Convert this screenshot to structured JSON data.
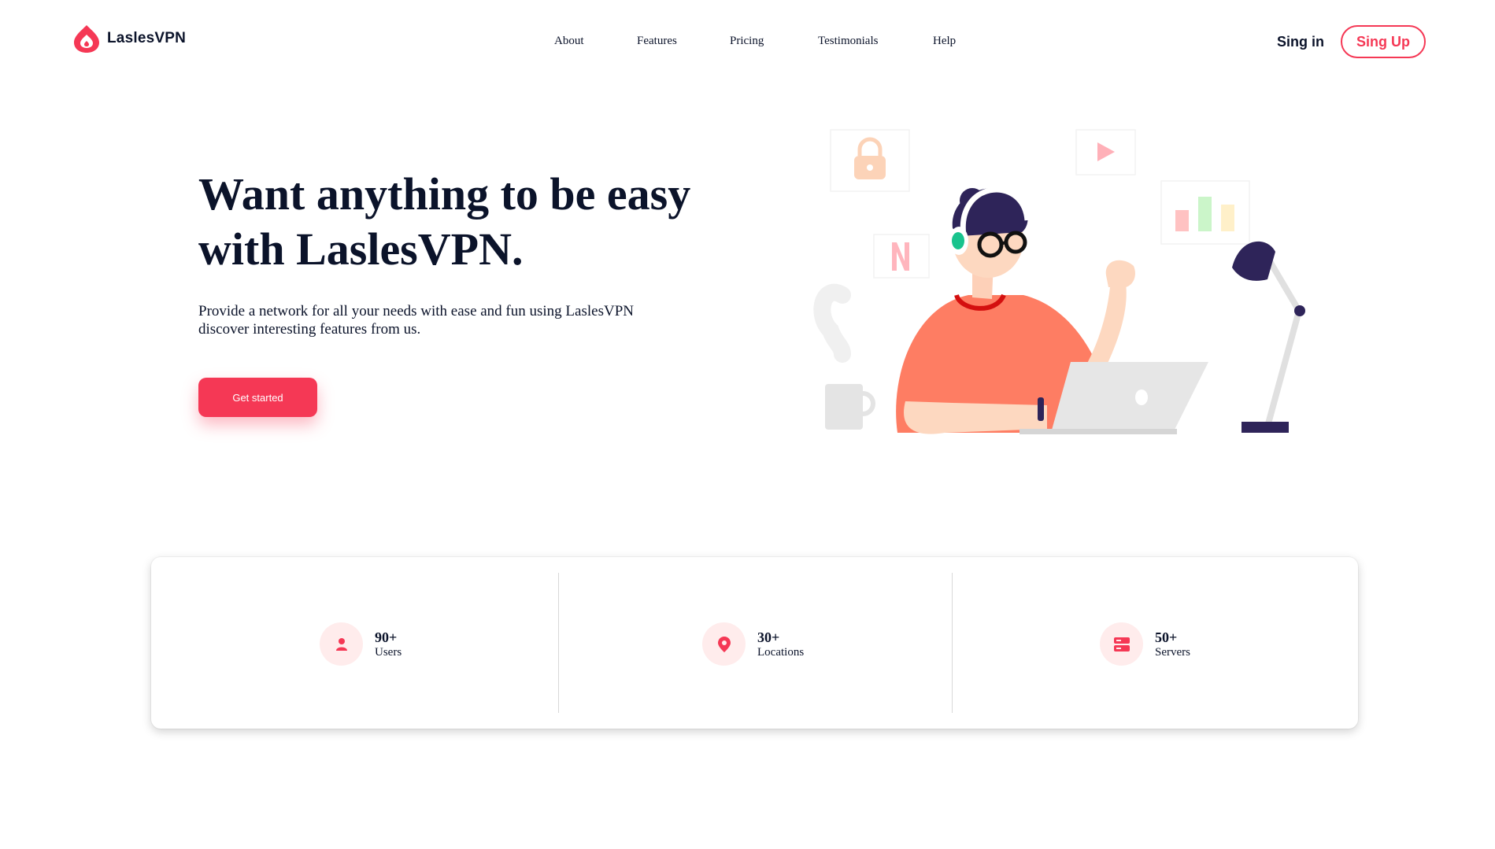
{
  "brand": {
    "name": "LaslesVPN",
    "accent": "#f53855",
    "dark": "#0b132a"
  },
  "nav": {
    "items": [
      "About",
      "Features",
      "Pricing",
      "Testimonials",
      "Help"
    ]
  },
  "auth": {
    "signin": "Sing in",
    "signup": "Sing Up"
  },
  "hero": {
    "title": "Want anything to be easy with LaslesVPN.",
    "subtitle_line1": "Provide a network for all your needs with ease and fun using LaslesVPN",
    "subtitle_line2": "discover interesting features from us.",
    "cta": "Get started",
    "illustration_icons": [
      "lock-icon",
      "play-icon",
      "bar-chart-icon",
      "netflix-icon"
    ]
  },
  "stats": [
    {
      "value": "90+",
      "label": "Users",
      "icon": "user-icon"
    },
    {
      "value": "30+",
      "label": "Locations",
      "icon": "location-pin-icon"
    },
    {
      "value": "50+",
      "label": "Servers",
      "icon": "server-icon"
    }
  ]
}
